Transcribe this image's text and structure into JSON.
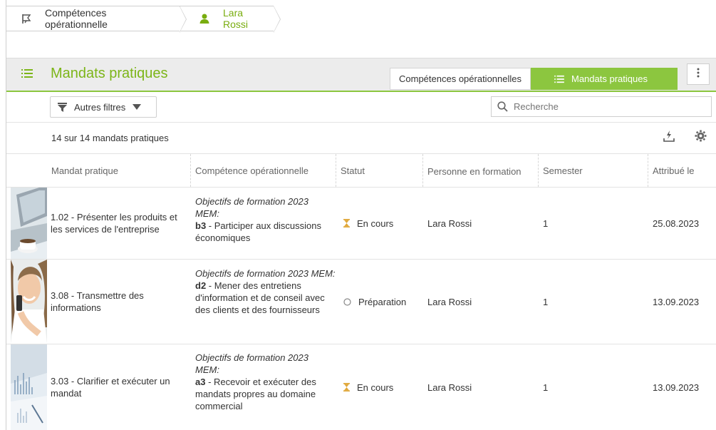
{
  "breadcrumb": {
    "items": [
      {
        "label": "Compétences opérationnelle",
        "icon": "flag-icon"
      },
      {
        "label": "Lara Rossi",
        "icon": "user-icon"
      }
    ]
  },
  "panel": {
    "title": "Mandats pratiques",
    "icon": "list-icon",
    "tabs": [
      {
        "label": "Compétences opérationnelles",
        "active": false
      },
      {
        "label": "Mandats pratiques",
        "active": true,
        "icon": "list-icon"
      }
    ],
    "menu_icon": "kebab-menu-icon"
  },
  "filters": {
    "other_filters_label": "Autres filtres",
    "search_placeholder": "Recherche"
  },
  "summary": {
    "count_text": "14 sur 14 mandats pratiques",
    "export_icon": "download-icon",
    "settings_icon": "gear-icon"
  },
  "table": {
    "columns": [
      "Mandat pratique",
      "Compétence opérationnelle",
      "Statut",
      "Personne en formation",
      "Semester",
      "Attribué le"
    ],
    "rows": [
      {
        "mandate": "1.02 - Présenter les produits et les services de l'entreprise",
        "objective_title": "Objectifs de formation 2023 MEM:",
        "objective_code": "b3",
        "objective_text": " - Participer aux discussions économiques",
        "status": "En cours",
        "status_icon": "hourglass-icon",
        "person": "Lara Rossi",
        "semester": "1",
        "assigned": "25.08.2023"
      },
      {
        "mandate": "3.08 - Transmettre des informations",
        "objective_title": "Objectifs de formation 2023 MEM:",
        "objective_code": "d2",
        "objective_text": " - Mener des entretiens d'information et de conseil avec des clients et des fournisseurs",
        "status": "Préparation",
        "status_icon": "circle-icon",
        "person": "Lara Rossi",
        "semester": "1",
        "assigned": "13.09.2023"
      },
      {
        "mandate": "3.03 - Clarifier et exécuter un mandat",
        "objective_title": "Objectifs de formation 2023 MEM:",
        "objective_code": "a3",
        "objective_text": " - Recevoir et exécuter des mandats propres au domaine commercial",
        "status": "En cours",
        "status_icon": "hourglass-icon",
        "person": "Lara Rossi",
        "semester": "1",
        "assigned": "13.09.2023"
      }
    ]
  },
  "colors": {
    "accent": "#8cc63f",
    "accent_text": "#7cb518",
    "status_in_progress": "#e0a83a"
  }
}
